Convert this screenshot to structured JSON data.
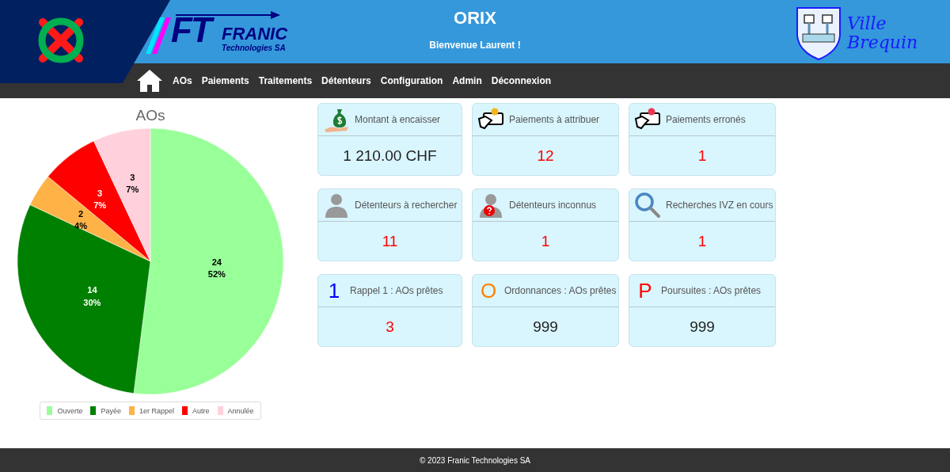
{
  "header": {
    "company_logo": {
      "mark": "FT",
      "name": "FRANIC",
      "subtitle": "Technologies SA"
    },
    "title": "ORIX",
    "welcome": "Bienvenue Laurent !",
    "city_logo": {
      "lines": [
        "Ville",
        "Brequin"
      ]
    }
  },
  "nav": {
    "items": [
      "AOs",
      "Paiements",
      "Traitements",
      "Détenteurs",
      "Configuration",
      "Admin",
      "Déconnexion"
    ]
  },
  "chart": {
    "chart_data": {
      "type": "pie",
      "title": "AOs",
      "categories": [
        "Ouverte",
        "Payée",
        "1er Rappel",
        "Autre",
        "Annulée"
      ],
      "value_labels": [
        [
          "24",
          "52%"
        ],
        [
          "14",
          "30%"
        ],
        [
          "2",
          "4%"
        ],
        [
          "3",
          "7%"
        ],
        [
          "3",
          "7%"
        ]
      ],
      "series": [
        {
          "values": [
            52,
            30,
            4,
            7,
            7
          ]
        }
      ],
      "colors": [
        "#99ff99",
        "#008000",
        "#ffb347",
        "#ff0000",
        "#ffd1dc"
      ]
    }
  },
  "cards": [
    {
      "kind": "money",
      "label": "Montant à encaisser",
      "value": "1 210.00 CHF",
      "alert": false
    },
    {
      "kind": "payment",
      "label": "Paiements à attribuer",
      "value": "12",
      "alert": true
    },
    {
      "kind": "payment-error",
      "label": "Paiements erronés",
      "value": "1",
      "alert": true
    },
    {
      "kind": "person",
      "label": "Détenteurs à rechercher",
      "value": "11",
      "alert": true
    },
    {
      "kind": "person-unknown",
      "label": "Détenteurs inconnus",
      "value": "1",
      "alert": true
    },
    {
      "kind": "search",
      "label": "Recherches IVZ en cours",
      "value": "1",
      "alert": true
    },
    {
      "kind": "letter",
      "letter": "1",
      "color": "#0000ff",
      "label": "Rappel 1 : AOs prêtes",
      "value": "3",
      "alert": true
    },
    {
      "kind": "letter",
      "letter": "O",
      "color": "#ff8000",
      "label": "Ordonnances : AOs prêtes",
      "value": "999",
      "alert": false
    },
    {
      "kind": "letter",
      "letter": "P",
      "color": "#ff0000",
      "label": "Poursuites : AOs prêtes",
      "value": "999",
      "alert": false
    }
  ],
  "footer": "© 2023 Franic Technologies SA"
}
